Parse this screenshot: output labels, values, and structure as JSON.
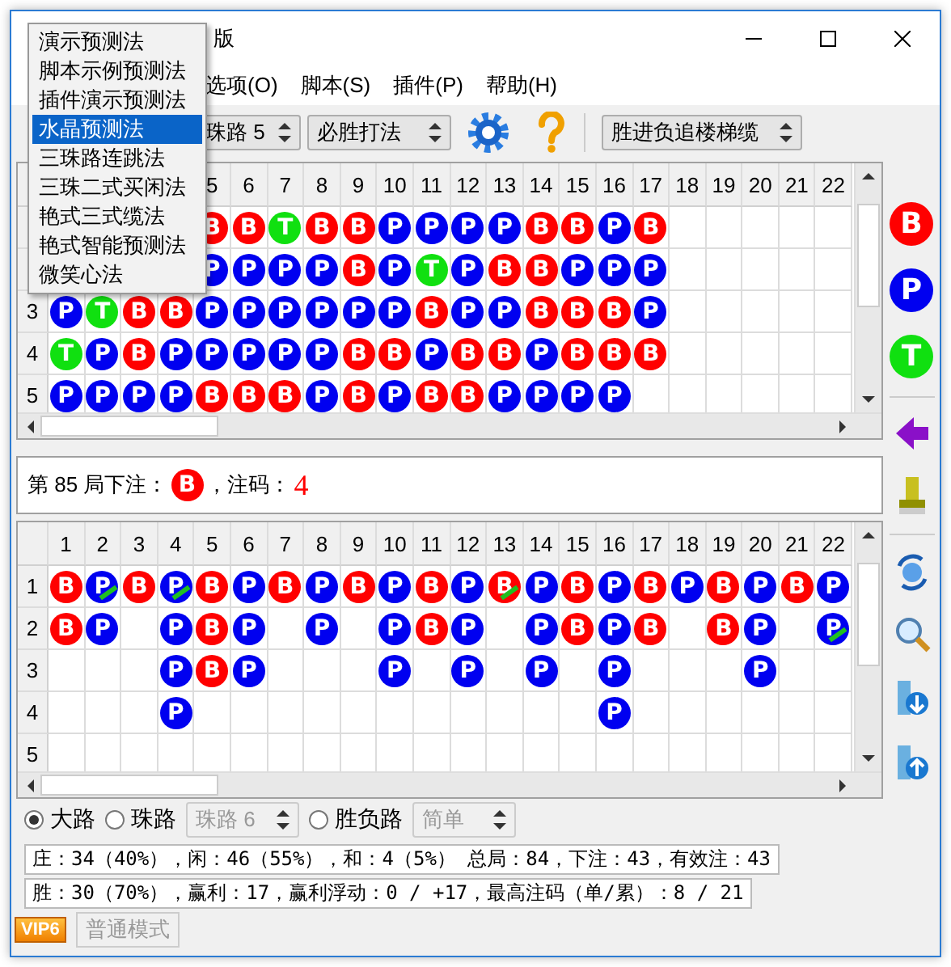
{
  "window": {
    "title": "版"
  },
  "menu_bar": [
    {
      "label": "选项(O)"
    },
    {
      "label": "脚本(S)"
    },
    {
      "label": "插件(P)"
    },
    {
      "label": "帮助(H)"
    }
  ],
  "toolbar": {
    "road_spin": "珠路 5",
    "method": "必胜打法",
    "strategy": "胜进负追楼梯缆"
  },
  "dropdown": [
    {
      "label": "演示预测法",
      "selected": false
    },
    {
      "label": "脚本示例预测法",
      "selected": false
    },
    {
      "label": "插件演示预测法",
      "selected": false
    },
    {
      "label": "水晶预测法",
      "selected": true
    },
    {
      "label": "三珠路连跳法",
      "selected": false
    },
    {
      "label": "三珠二式买闲法",
      "selected": false
    },
    {
      "label": "艳式三式缆法",
      "selected": false
    },
    {
      "label": "艳式智能预测法",
      "selected": false
    },
    {
      "label": "微笑心法",
      "selected": false
    }
  ],
  "top_grid": {
    "columns": [
      null,
      null,
      null,
      null,
      "5",
      "6",
      "7",
      "8",
      "9",
      "10",
      "11",
      "12",
      "13",
      "14",
      "15",
      "16",
      "17",
      "18",
      "19",
      "20",
      "21",
      "22"
    ],
    "rows": [
      {
        "label": null,
        "cells": [
          null,
          null,
          null,
          null,
          {
            "text": "B",
            "kind": "banker"
          },
          {
            "text": "B",
            "kind": "banker"
          },
          {
            "text": "T",
            "kind": "tie"
          },
          {
            "text": "B",
            "kind": "banker"
          },
          {
            "text": "B",
            "kind": "banker"
          },
          {
            "text": "P",
            "kind": "player"
          },
          {
            "text": "P",
            "kind": "player"
          },
          {
            "text": "P",
            "kind": "player"
          },
          {
            "text": "P",
            "kind": "player"
          },
          {
            "text": "B",
            "kind": "banker"
          },
          {
            "text": "B",
            "kind": "banker"
          },
          {
            "text": "P",
            "kind": "player"
          },
          {
            "text": "B",
            "kind": "banker"
          },
          null,
          null,
          null,
          null,
          null
        ]
      },
      {
        "label": null,
        "cells": [
          null,
          null,
          null,
          null,
          {
            "text": "P",
            "kind": "player"
          },
          {
            "text": "P",
            "kind": "player"
          },
          {
            "text": "P",
            "kind": "player"
          },
          {
            "text": "P",
            "kind": "player"
          },
          {
            "text": "B",
            "kind": "banker"
          },
          {
            "text": "P",
            "kind": "player"
          },
          {
            "text": "T",
            "kind": "tie"
          },
          {
            "text": "P",
            "kind": "player"
          },
          {
            "text": "B",
            "kind": "banker"
          },
          {
            "text": "B",
            "kind": "banker"
          },
          {
            "text": "P",
            "kind": "player"
          },
          {
            "text": "P",
            "kind": "player"
          },
          {
            "text": "P",
            "kind": "player"
          },
          null,
          null,
          null,
          null,
          null
        ]
      },
      {
        "label": "3",
        "cells": [
          {
            "text": "P",
            "kind": "player"
          },
          {
            "text": "T",
            "kind": "tie"
          },
          {
            "text": "B",
            "kind": "banker"
          },
          {
            "text": "B",
            "kind": "banker"
          },
          {
            "text": "P",
            "kind": "player"
          },
          {
            "text": "P",
            "kind": "player"
          },
          {
            "text": "P",
            "kind": "player"
          },
          {
            "text": "P",
            "kind": "player"
          },
          {
            "text": "P",
            "kind": "player"
          },
          {
            "text": "P",
            "kind": "player"
          },
          {
            "text": "B",
            "kind": "banker"
          },
          {
            "text": "P",
            "kind": "player"
          },
          {
            "text": "P",
            "kind": "player"
          },
          {
            "text": "B",
            "kind": "banker"
          },
          {
            "text": "B",
            "kind": "banker"
          },
          {
            "text": "B",
            "kind": "banker"
          },
          {
            "text": "P",
            "kind": "player"
          },
          null,
          null,
          null,
          null,
          null
        ]
      },
      {
        "label": "4",
        "cells": [
          {
            "text": "T",
            "kind": "tie"
          },
          {
            "text": "P",
            "kind": "player"
          },
          {
            "text": "B",
            "kind": "banker"
          },
          {
            "text": "P",
            "kind": "player"
          },
          {
            "text": "P",
            "kind": "player"
          },
          {
            "text": "P",
            "kind": "player"
          },
          {
            "text": "P",
            "kind": "player"
          },
          {
            "text": "P",
            "kind": "player"
          },
          {
            "text": "B",
            "kind": "banker"
          },
          {
            "text": "B",
            "kind": "banker"
          },
          {
            "text": "P",
            "kind": "player"
          },
          {
            "text": "B",
            "kind": "banker"
          },
          {
            "text": "B",
            "kind": "banker"
          },
          {
            "text": "P",
            "kind": "player"
          },
          {
            "text": "B",
            "kind": "banker"
          },
          {
            "text": "B",
            "kind": "banker"
          },
          {
            "text": "B",
            "kind": "banker"
          },
          null,
          null,
          null,
          null,
          null
        ]
      },
      {
        "label": "5",
        "cells": [
          {
            "text": "P",
            "kind": "player"
          },
          {
            "text": "P",
            "kind": "player"
          },
          {
            "text": "P",
            "kind": "player"
          },
          {
            "text": "P",
            "kind": "player"
          },
          {
            "text": "B",
            "kind": "banker"
          },
          {
            "text": "B",
            "kind": "banker"
          },
          {
            "text": "B",
            "kind": "banker"
          },
          {
            "text": "P",
            "kind": "player"
          },
          {
            "text": "B",
            "kind": "banker"
          },
          {
            "text": "P",
            "kind": "player"
          },
          {
            "text": "B",
            "kind": "banker"
          },
          {
            "text": "B",
            "kind": "banker"
          },
          {
            "text": "P",
            "kind": "player"
          },
          {
            "text": "P",
            "kind": "player"
          },
          {
            "text": "P",
            "kind": "player"
          },
          {
            "text": "P",
            "kind": "player"
          },
          null,
          null,
          null,
          null,
          null,
          null
        ]
      }
    ]
  },
  "bet": {
    "prefix": "第 85 局下注：",
    "bead": {
      "text": "B",
      "kind": "banker"
    },
    "middle": "，注码：",
    "amount": "4"
  },
  "bottom_grid": {
    "columns": [
      "1",
      "2",
      "3",
      "4",
      "5",
      "6",
      "7",
      "8",
      "9",
      "10",
      "11",
      "12",
      "13",
      "14",
      "15",
      "16",
      "17",
      "18",
      "19",
      "20",
      "21",
      "22"
    ],
    "rows": [
      {
        "label": "1",
        "cells": [
          {
            "text": "B",
            "kind": "banker",
            "tie": false
          },
          {
            "text": "P",
            "kind": "player",
            "tie": true
          },
          {
            "text": "B",
            "kind": "banker",
            "tie": false
          },
          {
            "text": "P",
            "kind": "player",
            "tie": true
          },
          {
            "text": "B",
            "kind": "banker",
            "tie": false
          },
          {
            "text": "P",
            "kind": "player",
            "tie": false
          },
          {
            "text": "B",
            "kind": "banker",
            "tie": false
          },
          {
            "text": "P",
            "kind": "player",
            "tie": false
          },
          {
            "text": "B",
            "kind": "banker",
            "tie": false
          },
          {
            "text": "P",
            "kind": "player",
            "tie": false
          },
          {
            "text": "B",
            "kind": "banker",
            "tie": false
          },
          {
            "text": "P",
            "kind": "player",
            "tie": false
          },
          {
            "text": "B",
            "kind": "banker",
            "tie": true
          },
          {
            "text": "P",
            "kind": "player",
            "tie": false
          },
          {
            "text": "B",
            "kind": "banker",
            "tie": false
          },
          {
            "text": "P",
            "kind": "player",
            "tie": false
          },
          {
            "text": "B",
            "kind": "banker",
            "tie": false
          },
          {
            "text": "P",
            "kind": "player",
            "tie": false
          },
          {
            "text": "B",
            "kind": "banker",
            "tie": false
          },
          {
            "text": "P",
            "kind": "player",
            "tie": false
          },
          {
            "text": "B",
            "kind": "banker",
            "tie": false
          },
          {
            "text": "P",
            "kind": "player",
            "tie": false
          }
        ]
      },
      {
        "label": "2",
        "cells": [
          {
            "text": "B",
            "kind": "banker",
            "tie": false
          },
          {
            "text": "P",
            "kind": "player",
            "tie": false
          },
          null,
          {
            "text": "P",
            "kind": "player",
            "tie": false
          },
          {
            "text": "B",
            "kind": "banker",
            "tie": false
          },
          {
            "text": "P",
            "kind": "player",
            "tie": false
          },
          null,
          {
            "text": "P",
            "kind": "player",
            "tie": false
          },
          null,
          {
            "text": "P",
            "kind": "player",
            "tie": false
          },
          {
            "text": "B",
            "kind": "banker",
            "tie": false
          },
          {
            "text": "P",
            "kind": "player",
            "tie": false
          },
          null,
          {
            "text": "P",
            "kind": "player",
            "tie": false
          },
          {
            "text": "B",
            "kind": "banker",
            "tie": false
          },
          {
            "text": "P",
            "kind": "player",
            "tie": false
          },
          {
            "text": "B",
            "kind": "banker",
            "tie": false
          },
          null,
          {
            "text": "B",
            "kind": "banker",
            "tie": false
          },
          {
            "text": "P",
            "kind": "player",
            "tie": false
          },
          null,
          {
            "text": "P",
            "kind": "player",
            "tie": true
          }
        ]
      },
      {
        "label": "3",
        "cells": [
          null,
          null,
          null,
          {
            "text": "P",
            "kind": "player",
            "tie": false
          },
          {
            "text": "B",
            "kind": "banker",
            "tie": false
          },
          {
            "text": "P",
            "kind": "player",
            "tie": false
          },
          null,
          null,
          null,
          {
            "text": "P",
            "kind": "player",
            "tie": false
          },
          null,
          {
            "text": "P",
            "kind": "player",
            "tie": false
          },
          null,
          {
            "text": "P",
            "kind": "player",
            "tie": false
          },
          null,
          {
            "text": "P",
            "kind": "player",
            "tie": false
          },
          null,
          null,
          null,
          {
            "text": "P",
            "kind": "player",
            "tie": false
          },
          null,
          null
        ]
      },
      {
        "label": "4",
        "cells": [
          null,
          null,
          null,
          {
            "text": "P",
            "kind": "player",
            "tie": false
          },
          null,
          null,
          null,
          null,
          null,
          null,
          null,
          null,
          null,
          null,
          null,
          {
            "text": "P",
            "kind": "player",
            "tie": false
          },
          null,
          null,
          null,
          null,
          null,
          null
        ]
      },
      {
        "label": "5",
        "cells": [
          null,
          null,
          null,
          null,
          null,
          null,
          null,
          null,
          null,
          null,
          null,
          null,
          null,
          null,
          null,
          null,
          null,
          null,
          null,
          null,
          null,
          null
        ]
      }
    ]
  },
  "side_buttons": [
    {
      "text": "B",
      "kind": "banker"
    },
    {
      "text": "P",
      "kind": "player"
    },
    {
      "text": "T",
      "kind": "tie"
    }
  ],
  "view_options": [
    {
      "kind": "radio",
      "label": "大路",
      "selected": true
    },
    {
      "kind": "radio",
      "label": "珠路",
      "selected": false
    },
    {
      "kind": "spin",
      "value": "珠路 6",
      "disabled": true
    },
    {
      "kind": "radio",
      "label": "胜负路",
      "selected": false
    },
    {
      "kind": "combo",
      "value": "简单",
      "disabled": true
    }
  ],
  "stats": [
    "庄：34（40%），闲：46（55%），和：4（5%） 总局：84，下注：43，有效注：43",
    "胜：30（70%），赢利：17，赢利浮动：0 / +17，最高注码（单/累）：8 / 21"
  ],
  "footer": {
    "badge": "VIP6",
    "mode_button": {
      "label": "普通模式",
      "disabled": true
    }
  }
}
